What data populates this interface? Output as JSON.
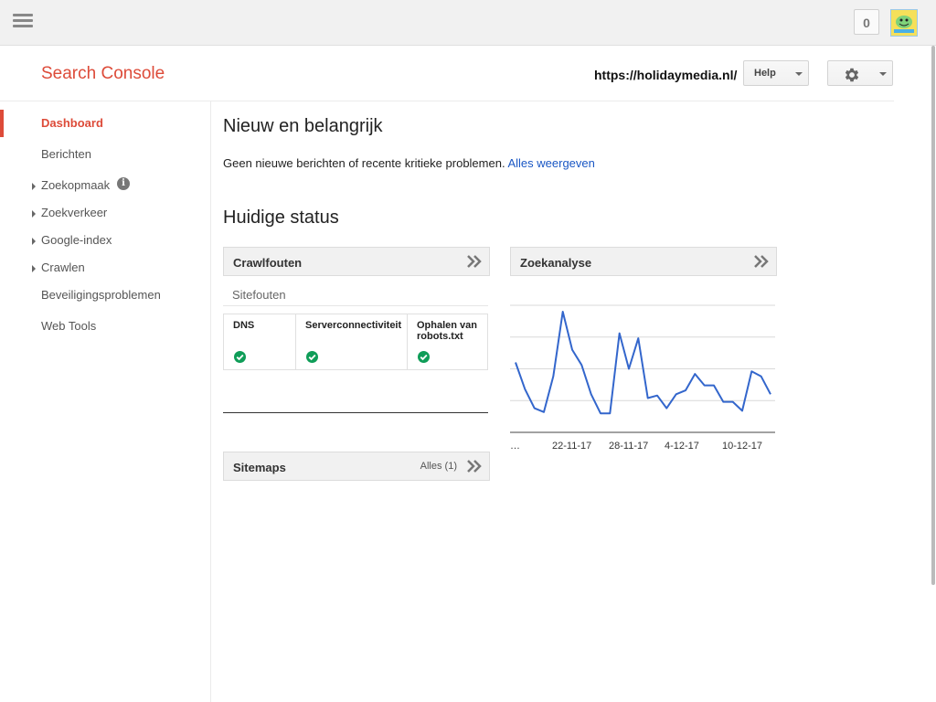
{
  "topbar": {
    "notification_count": "0"
  },
  "header": {
    "logo": "Search Console",
    "site_url": "https://holidaymedia.nl/",
    "help_label": "Help"
  },
  "sidebar": {
    "items": [
      {
        "label": "Dashboard"
      },
      {
        "label": "Berichten"
      },
      {
        "label": "Zoekopmaak"
      },
      {
        "label": "Zoekverkeer"
      },
      {
        "label": "Google-index"
      },
      {
        "label": "Crawlen"
      },
      {
        "label": "Beveiligingsproblemen"
      },
      {
        "label": "Web Tools"
      }
    ]
  },
  "main": {
    "new_heading": "Nieuw en belangrijk",
    "new_message": "Geen nieuwe berichten of recente kritieke problemen.",
    "new_link": "Alles weergeven",
    "status_heading": "Huidige status",
    "crawl": {
      "title": "Crawlfouten",
      "section": "Sitefouten",
      "columns": [
        {
          "label": "DNS",
          "status": "ok"
        },
        {
          "label": "Serverconnectiviteit",
          "status": "ok"
        },
        {
          "label": "Ophalen van robots.txt",
          "status": "ok"
        }
      ]
    },
    "sitemaps": {
      "title": "Sitemaps",
      "count_label": "Alles (1)"
    },
    "search": {
      "title": "Zoekanalyse"
    }
  },
  "chart_data": {
    "type": "line",
    "x_tick_labels": [
      "…",
      "22-11-17",
      "28-11-17",
      "4-12-17",
      "10-12-17"
    ],
    "series": [
      {
        "color": "#3366cc",
        "values": [
          0.55,
          0.34,
          0.19,
          0.16,
          0.44,
          0.95,
          0.65,
          0.53,
          0.3,
          0.15,
          0.15,
          0.78,
          0.5,
          0.74,
          0.27,
          0.29,
          0.19,
          0.3,
          0.33,
          0.46,
          0.37,
          0.37,
          0.24,
          0.24,
          0.17,
          0.48,
          0.44,
          0.3
        ]
      }
    ],
    "grid": true,
    "ylim": [
      0,
      1
    ]
  }
}
